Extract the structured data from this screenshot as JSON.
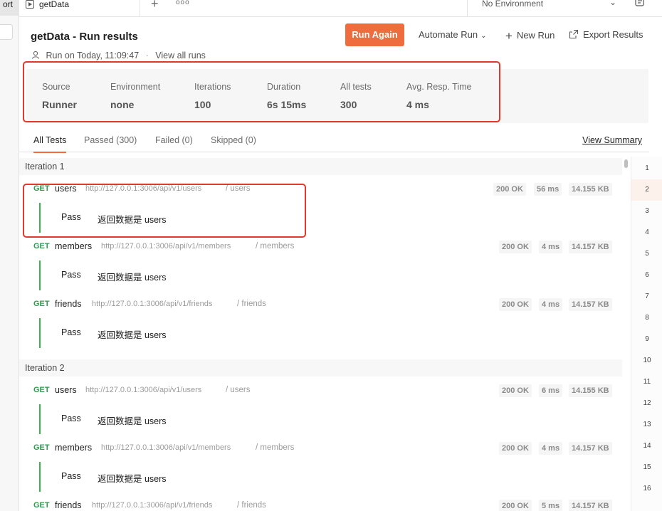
{
  "window": {
    "left_tab_fragment": "ort"
  },
  "tabbar": {
    "tab_label": "getData",
    "plus_icon": "+",
    "more_icon": "ooo",
    "environment": "No Environment"
  },
  "header": {
    "title": "getData - Run results",
    "run_on": "Run on Today, 11:09:47",
    "separator": "·",
    "view_all_runs": "View all runs",
    "run_again": "Run Again",
    "automate_run": "Automate Run",
    "new_run": "New Run",
    "export_results": "Export Results"
  },
  "summary": {
    "stats": [
      {
        "label": "Source",
        "value": "Runner"
      },
      {
        "label": "Environment",
        "value": "none"
      },
      {
        "label": "Iterations",
        "value": "100"
      },
      {
        "label": "Duration",
        "value": "6s 15ms"
      },
      {
        "label": "All tests",
        "value": "300"
      },
      {
        "label": "Avg. Resp. Time",
        "value": "4 ms"
      }
    ]
  },
  "filters": {
    "tabs": [
      "All Tests",
      "Passed (300)",
      "Failed (0)",
      "Skipped (0)"
    ],
    "view_summary": "View Summary"
  },
  "iterations": [
    {
      "title": "Iteration 1",
      "requests": [
        {
          "method": "GET",
          "name": "users",
          "url": "http://127.0.0.1:3006/api/v1/users",
          "path": "/ users",
          "status": "200 OK",
          "time": "56 ms",
          "size": "14.155 KB",
          "test_status": "Pass",
          "test_name": "返回数据是 users"
        },
        {
          "method": "GET",
          "name": "members",
          "url": "http://127.0.0.1:3006/api/v1/members",
          "path": "/ members",
          "status": "200 OK",
          "time": "4 ms",
          "size": "14.157 KB",
          "test_status": "Pass",
          "test_name": "返回数据是 users"
        },
        {
          "method": "GET",
          "name": "friends",
          "url": "http://127.0.0.1:3006/api/v1/friends",
          "path": "/ friends",
          "status": "200 OK",
          "time": "4 ms",
          "size": "14.157 KB",
          "test_status": "Pass",
          "test_name": "返回数据是 users"
        }
      ]
    },
    {
      "title": "Iteration 2",
      "requests": [
        {
          "method": "GET",
          "name": "users",
          "url": "http://127.0.0.1:3006/api/v1/users",
          "path": "/ users",
          "status": "200 OK",
          "time": "6 ms",
          "size": "14.155 KB",
          "test_status": "Pass",
          "test_name": "返回数据是 users"
        },
        {
          "method": "GET",
          "name": "members",
          "url": "http://127.0.0.1:3006/api/v1/members",
          "path": "/ members",
          "status": "200 OK",
          "time": "4 ms",
          "size": "14.157 KB",
          "test_status": "Pass",
          "test_name": "返回数据是 users"
        },
        {
          "method": "GET",
          "name": "friends",
          "url": "http://127.0.0.1:3006/api/v1/friends",
          "path": "/ friends",
          "status": "200 OK",
          "time": "5 ms",
          "size": "14.157 KB"
        }
      ]
    }
  ],
  "minimap": [
    "1",
    "2",
    "3",
    "4",
    "5",
    "6",
    "7",
    "8",
    "9",
    "10",
    "11",
    "12",
    "13",
    "14",
    "15",
    "16"
  ],
  "colors": {
    "accent": "#ef6c3f",
    "get_method": "#2d9d4f",
    "pass_bar": "#3cb44b",
    "annotation": "#e03a2e"
  }
}
